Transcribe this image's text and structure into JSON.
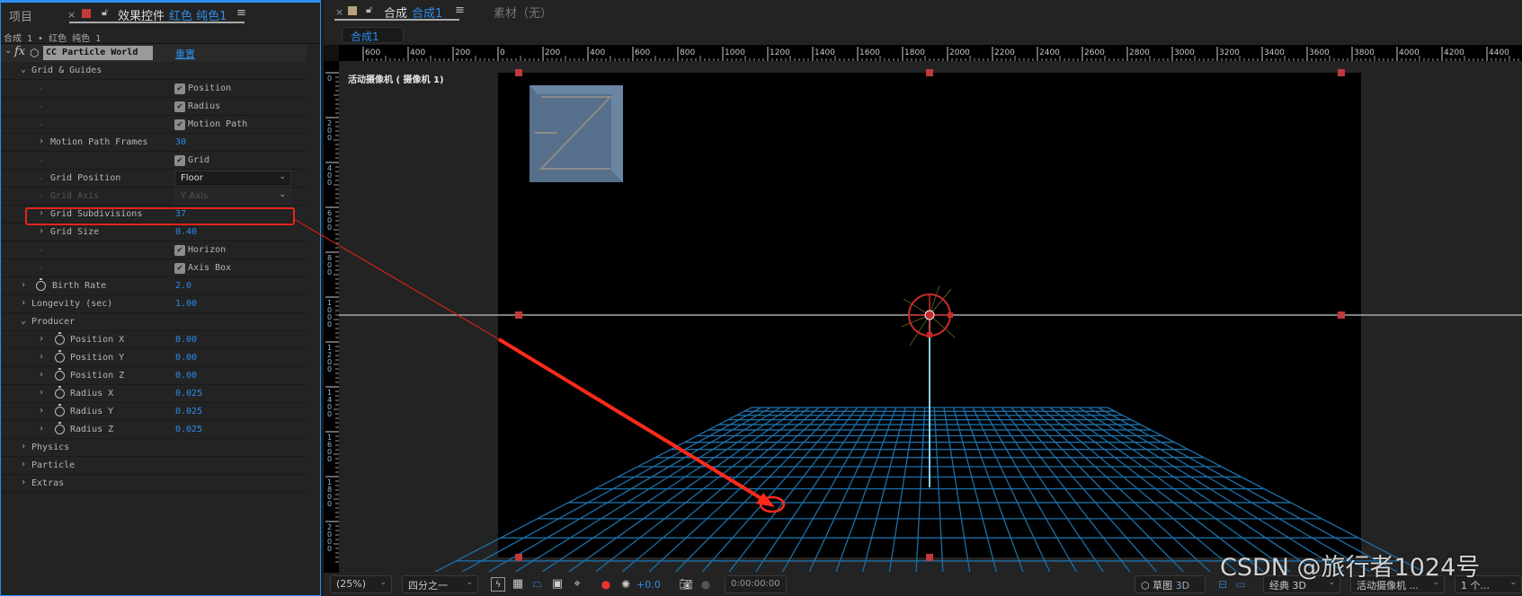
{
  "left_panel": {
    "tabs": {
      "project": "项目",
      "close": "×",
      "effect_controls": "效果控件",
      "layer_name": "红色 纯色1",
      "menu": "≡"
    },
    "breadcrumb": "合成 1 • 红色 纯色 1",
    "effect": {
      "name": "CC Particle World",
      "fx": "fx",
      "reset": "重置"
    },
    "rows": [
      {
        "label": "Grid & Guides",
        "type": "group",
        "level": 1,
        "expanded": true
      },
      {
        "label": "Position",
        "type": "checkbox",
        "checked": true
      },
      {
        "label": "Radius",
        "type": "checkbox",
        "checked": true
      },
      {
        "label": "Motion Path",
        "type": "checkbox",
        "checked": true
      },
      {
        "label": "Motion Path Frames",
        "type": "value",
        "level": 2,
        "value": "30"
      },
      {
        "label": "Grid",
        "type": "checkbox",
        "checked": true
      },
      {
        "label": "Grid Position",
        "type": "dropdown",
        "level": 2,
        "value": "Floor"
      },
      {
        "label": "Grid Axis",
        "type": "dropdown",
        "level": 2,
        "value": "Y Axis",
        "disabled": true
      },
      {
        "label": "Grid Subdivisions",
        "type": "value",
        "level": 2,
        "value": "37",
        "highlighted": true
      },
      {
        "label": "Grid Size",
        "type": "value",
        "level": 2,
        "value": "0.40"
      },
      {
        "label": "Horizon",
        "type": "checkbox",
        "checked": true
      },
      {
        "label": "Axis Box",
        "type": "checkbox",
        "checked": true
      },
      {
        "label": "Birth Rate",
        "type": "value",
        "level": 1,
        "stopwatch": true,
        "value": "2.0"
      },
      {
        "label": "Longevity (sec)",
        "type": "value",
        "level": 1,
        "value": "1.00"
      },
      {
        "label": "Producer",
        "type": "group",
        "level": 1,
        "expanded": true
      },
      {
        "label": "Position X",
        "type": "value",
        "level": 2,
        "stopwatch": true,
        "value": "0.00"
      },
      {
        "label": "Position Y",
        "type": "value",
        "level": 2,
        "stopwatch": true,
        "value": "0.00"
      },
      {
        "label": "Position Z",
        "type": "value",
        "level": 2,
        "stopwatch": true,
        "value": "0.00"
      },
      {
        "label": "Radius X",
        "type": "value",
        "level": 2,
        "stopwatch": true,
        "value": "0.025"
      },
      {
        "label": "Radius Y",
        "type": "value",
        "level": 2,
        "stopwatch": true,
        "value": "0.025"
      },
      {
        "label": "Radius Z",
        "type": "value",
        "level": 2,
        "stopwatch": true,
        "value": "0.025"
      },
      {
        "label": "Physics",
        "type": "group",
        "level": 1,
        "expanded": false
      },
      {
        "label": "Particle",
        "type": "group",
        "level": 1,
        "expanded": false
      },
      {
        "label": "Extras",
        "type": "group",
        "level": 1,
        "expanded": false
      }
    ]
  },
  "comp_panel": {
    "tabs": {
      "close": "×",
      "comp": "合成",
      "comp_name": "合成1",
      "menu": "≡",
      "footage": "素材（无）"
    },
    "sub_tab": "合成1",
    "view_label": "活动摄像机 ( 摄像机 1)",
    "ruler": {
      "h_labels": [
        "600",
        "400",
        "200",
        "0",
        "200",
        "400",
        "600",
        "800",
        "1000",
        "1200",
        "1400",
        "1600",
        "1800",
        "2000",
        "2200",
        "2400",
        "2600",
        "2800",
        "3000",
        "3200",
        "3400",
        "3600",
        "3800",
        "4000",
        "4200",
        "4400"
      ],
      "v_labels": [
        "0",
        "200",
        "400",
        "600",
        "800",
        "1000",
        "1200",
        "1400",
        "1600",
        "1800",
        "2000"
      ]
    },
    "grid_color": "#1c6fa8",
    "annotation_color": "#ff2a1a"
  },
  "toolbar": {
    "zoom": "(25%)",
    "resolution": "四分之一",
    "exposure": "+0.0",
    "timecode": "0:00:00:00",
    "draft3d": "草图",
    "draft3d_suffix": "3D",
    "renderer": "经典 3D",
    "camera": "活动摄像机 ...",
    "views": "1 个..."
  },
  "watermark": "CSDN @旅行者1024号"
}
